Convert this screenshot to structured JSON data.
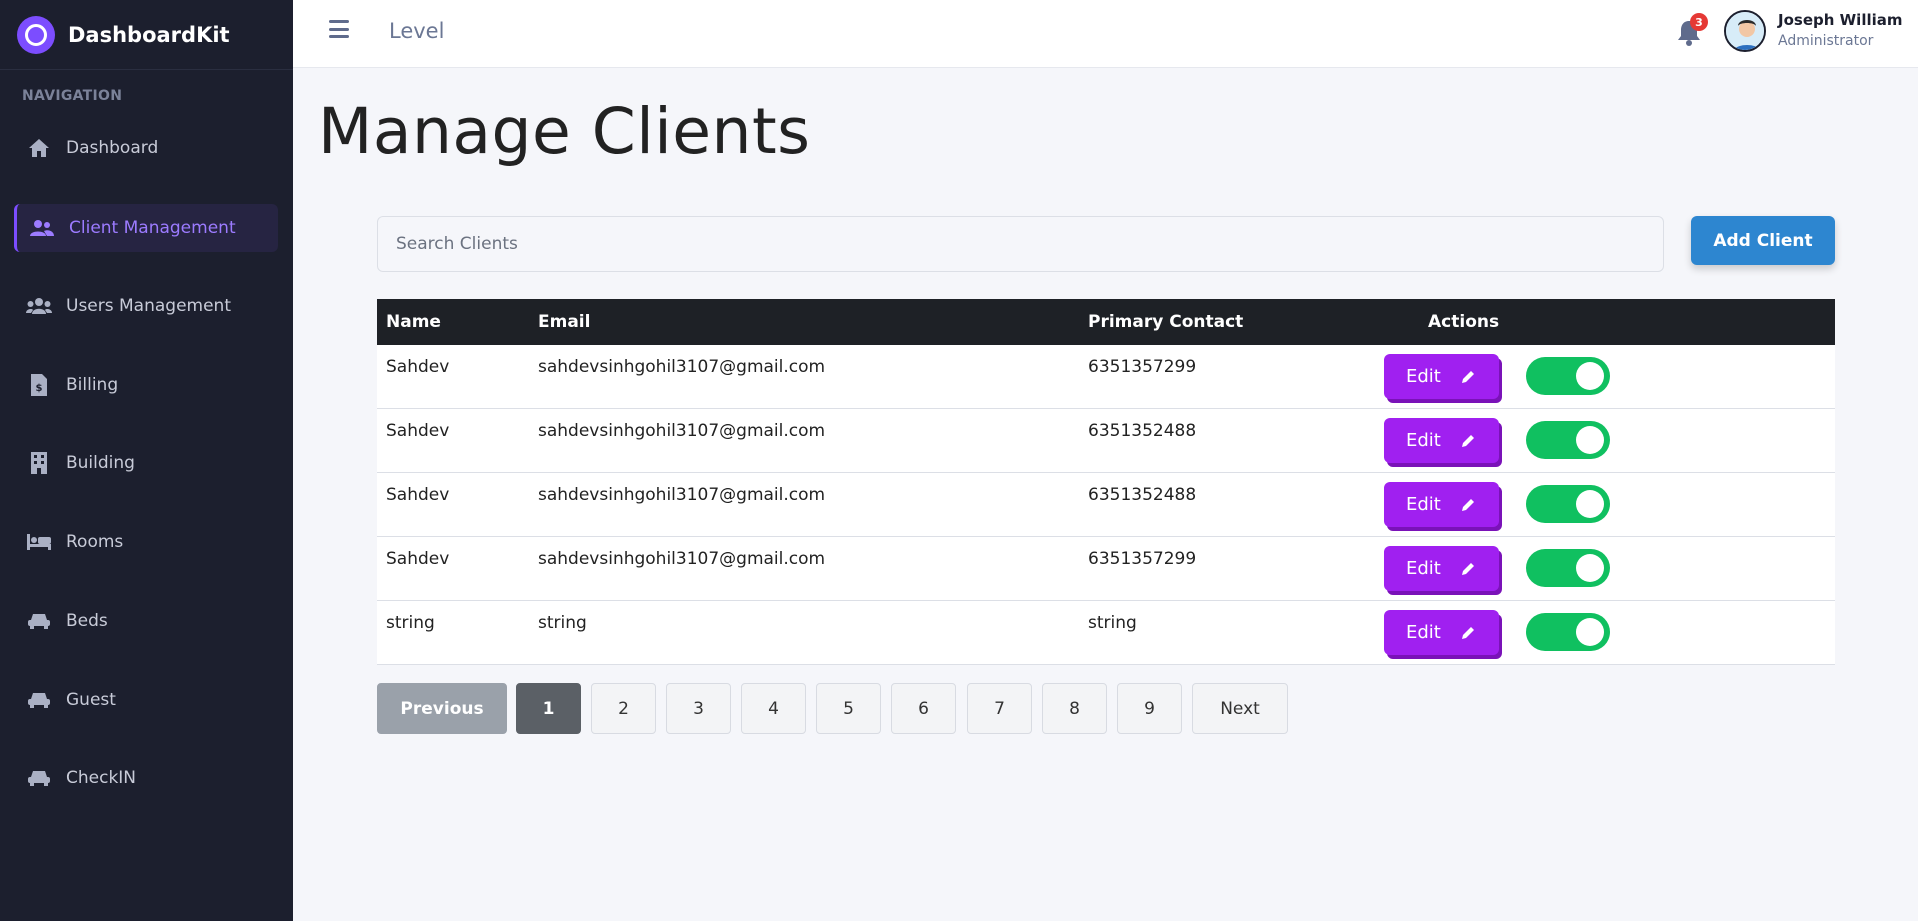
{
  "app": {
    "brand": "DashboardKit"
  },
  "sidebar": {
    "caption": "NAVIGATION",
    "items": [
      {
        "label": "Dashboard",
        "icon": "home-icon"
      },
      {
        "label": "Client Management",
        "icon": "users-icon",
        "active": true
      },
      {
        "label": "Users Management",
        "icon": "group-icon"
      },
      {
        "label": "Billing",
        "icon": "invoice-icon"
      },
      {
        "label": "Building",
        "icon": "building-icon"
      },
      {
        "label": "Rooms",
        "icon": "bed-icon"
      },
      {
        "label": "Beds",
        "icon": "car-icon"
      },
      {
        "label": "Guest",
        "icon": "car-icon"
      },
      {
        "label": "CheckIN",
        "icon": "car-icon"
      }
    ]
  },
  "header": {
    "breadcrumb": "Level",
    "notification_count": "3",
    "user_name": "Joseph William",
    "user_role": "Administrator"
  },
  "main": {
    "title": "Manage Clients",
    "search_placeholder": "Search Clients",
    "add_label": "Add Client",
    "columns": [
      "Name",
      "Email",
      "Primary Contact",
      "Actions"
    ],
    "rows": [
      {
        "name": "Sahdev",
        "email": "sahdevsinhgohil3107@gmail.com",
        "phone": "6351357299",
        "enabled": true
      },
      {
        "name": "Sahdev",
        "email": "sahdevsinhgohil3107@gmail.com",
        "phone": "6351352488",
        "enabled": true
      },
      {
        "name": "Sahdev",
        "email": "sahdevsinhgohil3107@gmail.com",
        "phone": "6351352488",
        "enabled": true
      },
      {
        "name": "Sahdev",
        "email": "sahdevsinhgohil3107@gmail.com",
        "phone": "6351357299",
        "enabled": true
      },
      {
        "name": "string",
        "email": "string",
        "phone": "string",
        "enabled": true
      }
    ],
    "edit_label": "Edit"
  },
  "pagination": {
    "previous": "Previous",
    "pages": [
      "1",
      "2",
      "3",
      "4",
      "5",
      "6",
      "7",
      "8",
      "9"
    ],
    "current": "1",
    "next": "Next"
  },
  "colors": {
    "sidebar_bg": "#1c1f2e",
    "accent": "#7c4dff",
    "edit_button": "#a020f0",
    "toggle_on": "#10c060",
    "add_button": "#2d86d0"
  }
}
